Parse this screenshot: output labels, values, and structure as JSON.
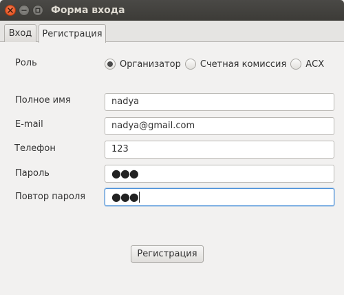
{
  "window": {
    "title": "Форма входа"
  },
  "tabs": [
    {
      "label": "Вход",
      "active": false
    },
    {
      "label": "Регистрация",
      "active": true
    }
  ],
  "form": {
    "role": {
      "label": "Роль",
      "options": [
        {
          "label": "Организатор",
          "selected": true
        },
        {
          "label": "Счетная комиссия",
          "selected": false
        },
        {
          "label": "АСХ",
          "selected": false
        }
      ]
    },
    "full_name": {
      "label": "Полное имя",
      "value": "nadya"
    },
    "email": {
      "label": "E-mail",
      "value": "nadya@gmail.com"
    },
    "phone": {
      "label": "Телефон",
      "value": "123"
    },
    "password": {
      "label": "Пароль",
      "masked_value": "●●●"
    },
    "password_repeat": {
      "label": "Повтор пароля",
      "masked_value": "●●●",
      "focused": true
    },
    "submit_label": "Регистрация"
  },
  "colors": {
    "window_bg": "#f2f1f0",
    "titlebar": "#3c3b37",
    "close_button": "#df4b16",
    "focus_border": "#4a90d9"
  },
  "icons": [
    "close-icon",
    "minimize-icon",
    "maximize-icon"
  ]
}
